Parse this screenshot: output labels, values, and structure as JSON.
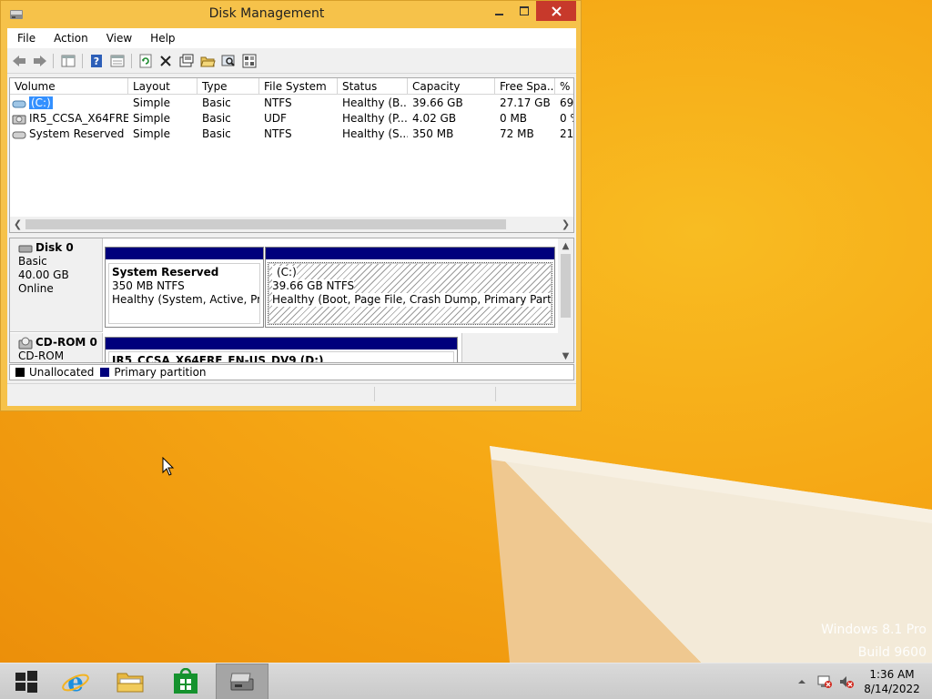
{
  "window": {
    "title": "Disk Management"
  },
  "menu": [
    "File",
    "Action",
    "View",
    "Help"
  ],
  "volume_list": {
    "columns": [
      "Volume",
      "Layout",
      "Type",
      "File System",
      "Status",
      "Capacity",
      "Free Spa...",
      "% F"
    ],
    "rows": [
      {
        "volume": "(C:)",
        "layout": "Simple",
        "type": "Basic",
        "fs": "NTFS",
        "status": "Healthy (B...",
        "capacity": "39.66 GB",
        "free": "27.17 GB",
        "pct": "69",
        "selected": true
      },
      {
        "volume": "IR5_CCSA_X64FRE...",
        "layout": "Simple",
        "type": "Basic",
        "fs": "UDF",
        "status": "Healthy (P...",
        "capacity": "4.02 GB",
        "free": "0 MB",
        "pct": "0 %",
        "selected": false
      },
      {
        "volume": "System Reserved",
        "layout": "Simple",
        "type": "Basic",
        "fs": "NTFS",
        "status": "Healthy (S...",
        "capacity": "350 MB",
        "free": "72 MB",
        "pct": "21",
        "selected": false
      }
    ]
  },
  "disks": {
    "disk0": {
      "name": "Disk 0",
      "type": "Basic",
      "size": "40.00 GB",
      "state": "Online",
      "partitions": [
        {
          "name": "System Reserved",
          "size": "350 MB NTFS",
          "status": "Healthy (System, Active, Prima"
        },
        {
          "name": "(C:)",
          "size": "39.66 GB NTFS",
          "status": "Healthy (Boot, Page File, Crash Dump, Primary Partition)"
        }
      ]
    },
    "cdrom0": {
      "name": "CD-ROM 0",
      "type": "CD-ROM",
      "partition_name": "IR5_CCSA_X64FRE_EN-US_DV9  (D:)"
    }
  },
  "legend": {
    "unallocated": "Unallocated",
    "primary": "Primary partition"
  },
  "colors": {
    "partition_bar": "#00007c",
    "unallocated": "#000000",
    "selection": "#3390ff",
    "close_button": "#c7392b"
  },
  "watermark": {
    "line1": "Windows 8.1 Pro",
    "line2": "Build 9600"
  },
  "clock": {
    "time": "1:36 AM",
    "date": "8/14/2022"
  }
}
